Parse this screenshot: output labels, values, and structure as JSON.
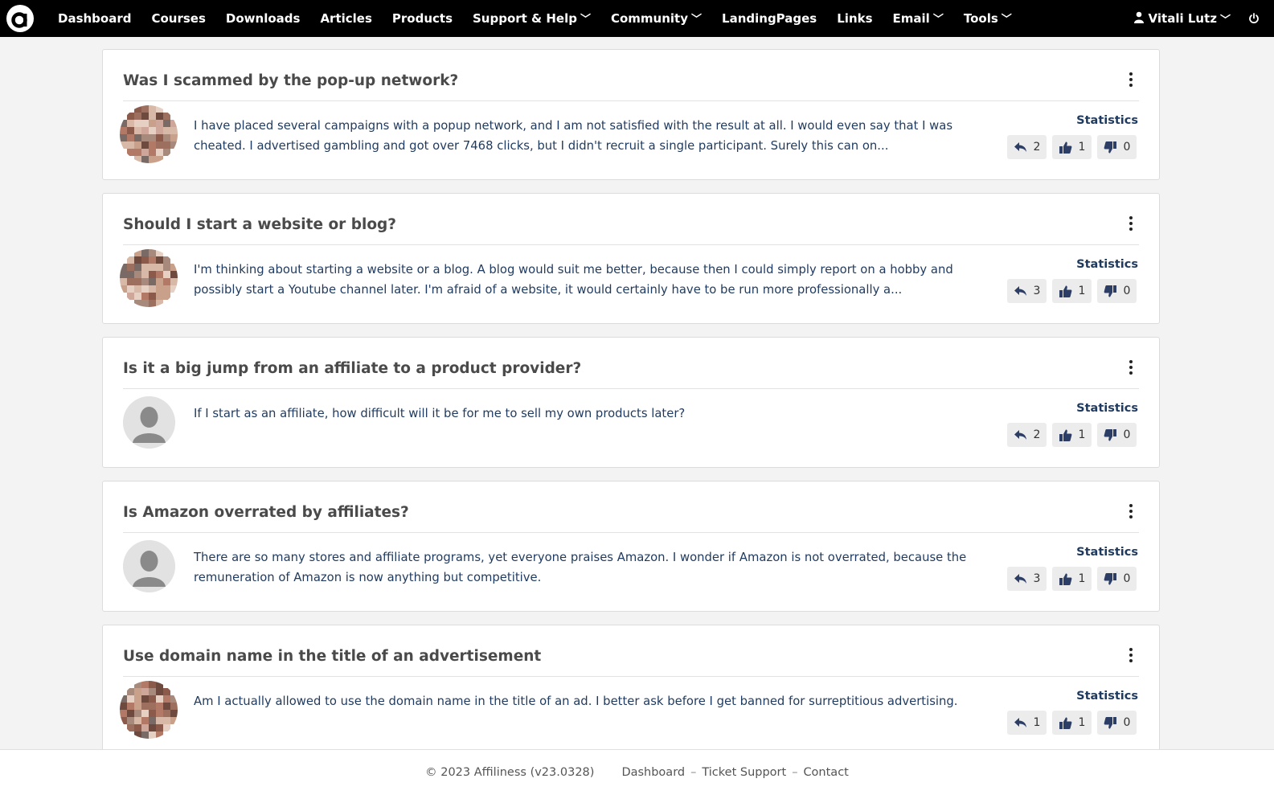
{
  "nav": {
    "logo_icon": "affiliness-logo-icon",
    "items": [
      {
        "label": "Dashboard",
        "dropdown": false
      },
      {
        "label": "Courses",
        "dropdown": false
      },
      {
        "label": "Downloads",
        "dropdown": false
      },
      {
        "label": "Articles",
        "dropdown": false
      },
      {
        "label": "Products",
        "dropdown": false
      },
      {
        "label": "Support & Help",
        "dropdown": true
      },
      {
        "label": "Community",
        "dropdown": true
      },
      {
        "label": "LandingPages",
        "dropdown": false
      },
      {
        "label": "Links",
        "dropdown": false
      },
      {
        "label": "Email",
        "dropdown": true
      },
      {
        "label": "Tools",
        "dropdown": true
      }
    ],
    "user_name": "Vitali Lutz",
    "user_icon": "user-icon",
    "logout_icon": "power-icon"
  },
  "posts": [
    {
      "title": "Was I scammed by the pop-up network?",
      "text": "I have placed several campaigns with a popup network, and I am not satisfied with the result at all. I would even say that I was cheated. I advertised gambling and got over 7468 clicks, but I didn't recruit a single participant. Surely this can on...",
      "avatar": "pixelated-photo",
      "stats_label": "Statistics",
      "replies": "2",
      "likes": "1",
      "dislikes": "0"
    },
    {
      "title": "Should I start a website or blog?",
      "text": "I'm thinking about starting a website or a blog. A blog would suit me better, because then I could simply report on a hobby and possibly start a Youtube channel later. I'm afraid of a website, it would certainly have to be run more professionally a...",
      "avatar": "pixelated-photo",
      "stats_label": "Statistics",
      "replies": "3",
      "likes": "1",
      "dislikes": "0"
    },
    {
      "title": "Is it a big jump from an affiliate to a product provider?",
      "text": "If I start as an affiliate, how difficult will it be for me to sell my own products later?",
      "avatar": "default",
      "stats_label": "Statistics",
      "replies": "2",
      "likes": "1",
      "dislikes": "0"
    },
    {
      "title": "Is Amazon overrated by affiliates?",
      "text": "There are so many stores and affiliate programs, yet everyone praises Amazon. I wonder if Amazon is not overrated, because the remuneration of Amazon is now anything but competitive.",
      "avatar": "default",
      "stats_label": "Statistics",
      "replies": "3",
      "likes": "1",
      "dislikes": "0"
    },
    {
      "title": "Use domain name in the title of an advertisement",
      "text": "Am I actually allowed to use the domain name in the title of an ad. I better ask before I get banned for surreptitious advertising.",
      "avatar": "pixelated-photo",
      "stats_label": "Statistics",
      "replies": "1",
      "likes": "1",
      "dislikes": "0"
    }
  ],
  "footer": {
    "copyright": "© 2023 Affiliness (v23.0328)",
    "links": [
      "Dashboard",
      "Ticket Support",
      "Contact"
    ]
  },
  "colors": {
    "topbar": "#000000",
    "accent_text": "#1f3a5f",
    "icon": "#2c3e66",
    "card_bg": "#ffffff",
    "page_bg": "#f3f3f3"
  }
}
